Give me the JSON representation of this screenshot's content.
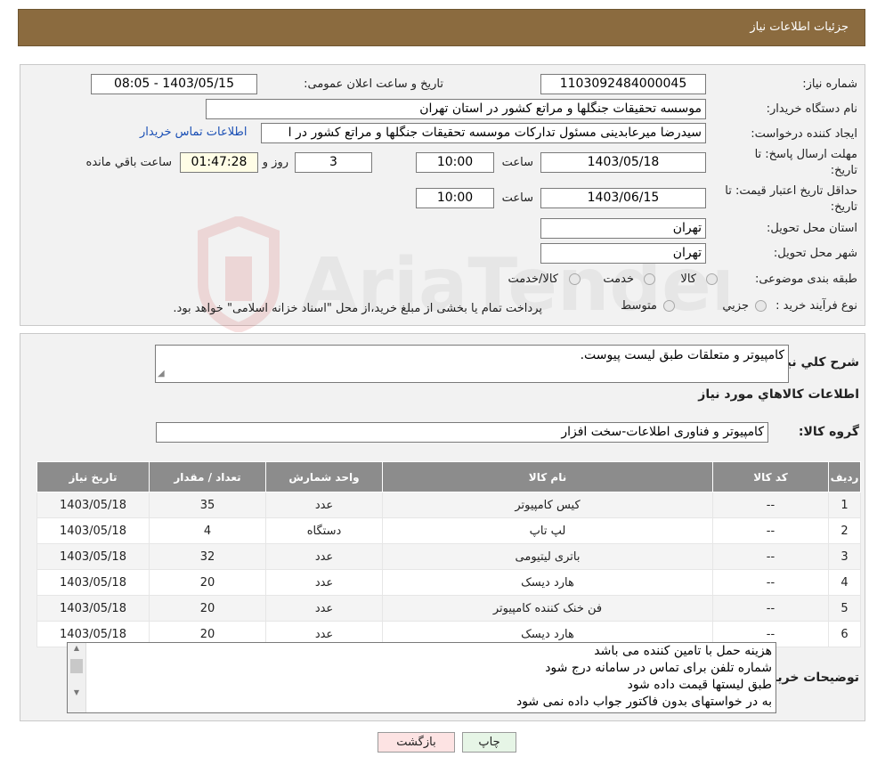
{
  "header": {
    "title": "جزئیات اطلاعات نیاز"
  },
  "form": {
    "need_number_label": "شماره نیاز:",
    "need_number": "1103092484000045",
    "announce_label": "تاریخ و ساعت اعلان عمومی:",
    "announce_value": "1403/05/15 - 08:05",
    "buyer_org_label": "نام دستگاه خریدار:",
    "buyer_org": "موسسه تحقیقات جنگلها و مراتع کشور در استان تهران",
    "creator_label": "ایجاد کننده درخواست:",
    "creator": "سیدرضا میرعابدینی مسئول تدارکات موسسه تحقیقات جنگلها و مراتع کشور در ا",
    "contact_link": "اطلاعات تماس خریدار",
    "deadline_label_1": "مهلت ارسال پاسخ: تا",
    "deadline_label_2": "تاریخ:",
    "deadline_date": "1403/05/18",
    "time_label": "ساعت",
    "deadline_time": "10:00",
    "days_value": "3",
    "days_label": "روز و",
    "remaining_time": "01:47:28",
    "remaining_label": "ساعت باقي مانده",
    "validity_label_1": "حداقل تاریخ اعتبار قیمت: تا",
    "validity_label_2": "تاریخ:",
    "validity_date": "1403/06/15",
    "validity_time": "10:00",
    "province_label": "استان محل تحویل:",
    "province": "تهران",
    "city_label": "شهر محل تحویل:",
    "city": "تهران",
    "category_label": "طبقه بندی موضوعی:",
    "category_options": [
      "کالا",
      "خدمت",
      "کالا/خدمت"
    ],
    "process_label": "نوع فرآیند خرید :",
    "process_options": [
      "جزیي",
      "متوسط"
    ],
    "process_note": "پرداخت تمام یا بخشی از مبلغ خرید،از محل \"اسناد خزانه اسلامی\" خواهد بود."
  },
  "watermark": "AriaTender.neT",
  "description": {
    "label": "شرح کلي نياز:",
    "text": "کامپیوتر و متعلقات طبق لیست پیوست."
  },
  "goods": {
    "section_title": "اطلاعات کالاهاي مورد نياز",
    "group_label": "گروه کالا:",
    "group_value": "کامپیوتر و فناوری اطلاعات-سخت افزار",
    "columns": [
      "رديف",
      "کد کالا",
      "نام کالا",
      "واحد شمارش",
      "تعداد / مقدار",
      "تاريخ نياز"
    ],
    "rows": [
      [
        "1",
        "--",
        "کیس کامپیوتر",
        "عدد",
        "35",
        "1403/05/18"
      ],
      [
        "2",
        "--",
        "لپ تاپ",
        "دستگاه",
        "4",
        "1403/05/18"
      ],
      [
        "3",
        "--",
        "باتری لیتیومی",
        "عدد",
        "32",
        "1403/05/18"
      ],
      [
        "4",
        "--",
        "هارد دیسک",
        "عدد",
        "20",
        "1403/05/18"
      ],
      [
        "5",
        "--",
        "فن خنک کننده کامپیوتر",
        "عدد",
        "20",
        "1403/05/18"
      ],
      [
        "6",
        "--",
        "هارد دیسک",
        "عدد",
        "20",
        "1403/05/18"
      ]
    ]
  },
  "buyer_notes": {
    "label": "توضیحات خریدار:",
    "lines": [
      "هزینه حمل با تامین کننده می باشد",
      "شماره تلفن برای تماس در سامانه درج شود",
      "طبق لیستها قیمت داده شود",
      "به در خواستهای بدون فاکتور جواب داده نمی شود"
    ]
  },
  "buttons": {
    "print": "چاپ",
    "back": "بازگشت"
  }
}
